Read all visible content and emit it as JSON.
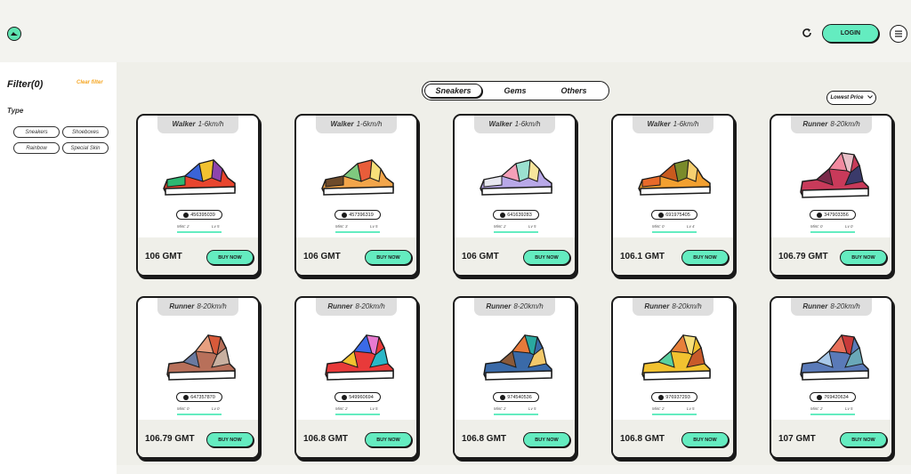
{
  "header": {
    "login_label": "LOGIN",
    "logo_icon": "stepn-logo-icon",
    "refresh_icon": "refresh-icon",
    "menu_icon": "menu-icon"
  },
  "sidebar": {
    "filter_title": "Filter(0)",
    "clear_filter": "Clear filter",
    "type_label": "Type",
    "chips": [
      "Sneakers",
      "Shoeboxes",
      "Rainbow",
      "Special Skin"
    ]
  },
  "main": {
    "tabs": [
      "Sneakers",
      "Gems",
      "Others"
    ],
    "active_tab": "Sneakers",
    "sort_label": "Lowest Price"
  },
  "colors": {
    "accent": "#64ecc0",
    "clear_filter": "#f5a623",
    "background": "#efefe9"
  },
  "cards": [
    {
      "type": "Walker",
      "speed": "1-6km/h",
      "id": "456395039",
      "mint": "Mint: 2",
      "level": "Lv 5",
      "price": "106 GMT",
      "buy": "BUY NOW"
    },
    {
      "type": "Walker",
      "speed": "1-6km/h",
      "id": "457396319",
      "mint": "Mint: 3",
      "level": "Lv 5",
      "price": "106 GMT",
      "buy": "BUY NOW"
    },
    {
      "type": "Walker",
      "speed": "1-6km/h",
      "id": "641639283",
      "mint": "Mint: 2",
      "level": "Lv 5",
      "price": "106 GMT",
      "buy": "BUY NOW"
    },
    {
      "type": "Walker",
      "speed": "1-6km/h",
      "id": "691975405",
      "mint": "Mint: 0",
      "level": "Lv 4",
      "price": "106.1 GMT",
      "buy": "BUY NOW"
    },
    {
      "type": "Runner",
      "speed": "8-20km/h",
      "id": "347903356",
      "mint": "Mint: 0",
      "level": "Lv 0",
      "price": "106.79 GMT",
      "buy": "BUY NOW"
    },
    {
      "type": "Runner",
      "speed": "8-20km/h",
      "id": "647357870",
      "mint": "Mint: 0",
      "level": "Lv 0",
      "price": "106.79 GMT",
      "buy": "BUY NOW"
    },
    {
      "type": "Runner",
      "speed": "8-20km/h",
      "id": "549960694",
      "mint": "Mint: 2",
      "level": "Lv 5",
      "price": "106.8 GMT",
      "buy": "BUY NOW"
    },
    {
      "type": "Runner",
      "speed": "8-20km/h",
      "id": "974540536",
      "mint": "Mint: 2",
      "level": "Lv 5",
      "price": "106.8 GMT",
      "buy": "BUY NOW"
    },
    {
      "type": "Runner",
      "speed": "8-20km/h",
      "id": "976937293",
      "mint": "Mint: 2",
      "level": "Lv 5",
      "price": "106.8 GMT",
      "buy": "BUY NOW"
    },
    {
      "type": "Runner",
      "speed": "8-20km/h",
      "id": "769420634",
      "mint": "Mint: 2",
      "level": "Lv 5",
      "price": "107 GMT",
      "buy": "BUY NOW"
    }
  ]
}
